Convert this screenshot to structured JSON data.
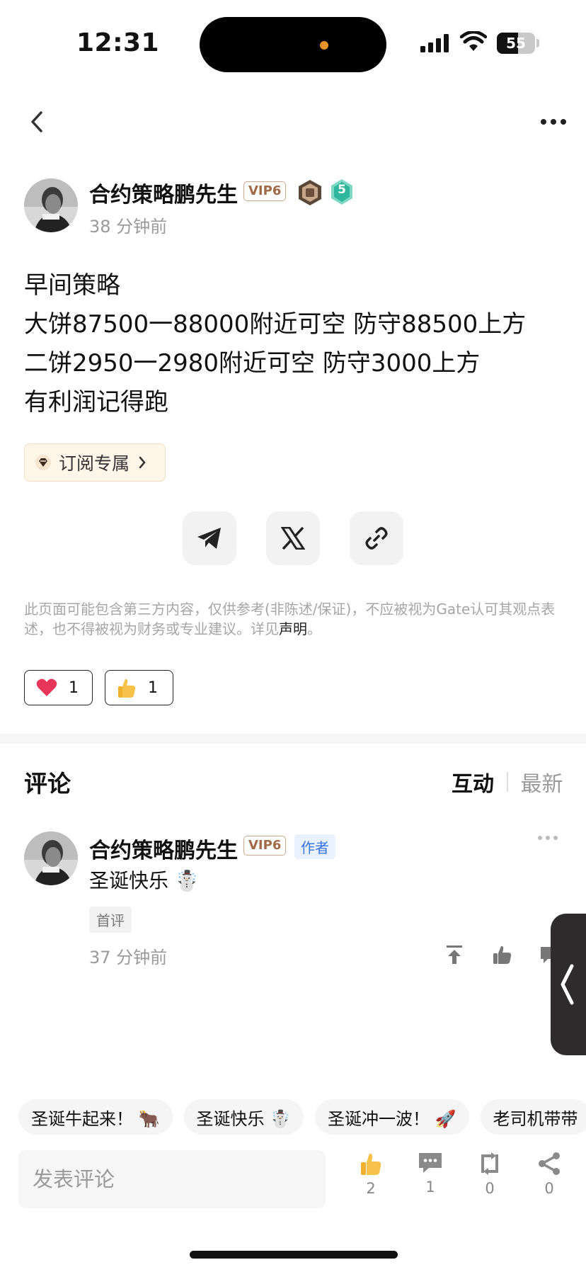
{
  "status_bar": {
    "time": "12:31",
    "battery": "55",
    "battery_level": 0.55
  },
  "nav": {
    "back_icon": "chevron-left-icon",
    "more_icon": "more-horizontal-icon"
  },
  "post": {
    "author": "合约策略鹏先生",
    "vip": "VIP6",
    "level": "5",
    "time": "38 分钟前",
    "content": [
      "早间策略",
      "大饼87500一88000附近可空 防守88500上方",
      "二饼2950一2980附近可空 防守3000上方",
      "有利润记得跑"
    ],
    "subscribe_label": "订阅专属",
    "share_icons": [
      "telegram-icon",
      "x-icon",
      "link-icon"
    ],
    "disclaimer": "此页面可能包含第三方内容，仅供参考(非陈述/保证)，不应被视为Gate认可其观点表述，也不得被视为财务或专业建议。详见",
    "disclaimer_link": "声明",
    "disclaimer_end": "。",
    "reactions": [
      {
        "icon": "heart-icon",
        "count": "1"
      },
      {
        "icon": "thumbs-up-icon",
        "count": "1"
      }
    ]
  },
  "comments": {
    "title": "评论",
    "sort_active": "互动",
    "sort_other": "最新",
    "items": [
      {
        "author": "合约策略鹏先生",
        "vip": "VIP6",
        "tag": "作者",
        "text": "圣诞快乐 ☃️",
        "badge": "首评",
        "time": "37 分钟前"
      }
    ]
  },
  "quick_replies": [
    "圣诞牛起来！ 🐂",
    "圣诞快乐 ☃️",
    "圣诞冲一波！ 🚀",
    "老司机带带"
  ],
  "bottom_bar": {
    "input_placeholder": "发表评论",
    "like_count": "2",
    "comment_count": "1",
    "repost_count": "0",
    "share_count": "0"
  }
}
